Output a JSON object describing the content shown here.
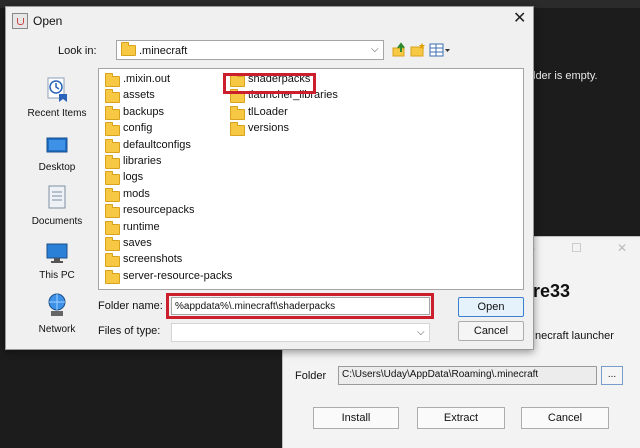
{
  "background": {
    "text": "lder is empty."
  },
  "installer": {
    "heading": "re33",
    "description": "necraft launcher",
    "folder_label": "Folder",
    "folder_value": "C:\\Users\\Uday\\AppData\\Roaming\\.minecraft",
    "browse_label": "...",
    "install_label": "Install",
    "extract_label": "Extract",
    "cancel_label": "Cancel"
  },
  "dialog": {
    "title": "Open",
    "look_in_label": "Look in:",
    "look_in_value": ".minecraft",
    "places": [
      {
        "label": "Recent Items",
        "icon": "recent-items-icon"
      },
      {
        "label": "Desktop",
        "icon": "desktop-icon"
      },
      {
        "label": "Documents",
        "icon": "documents-icon"
      },
      {
        "label": "This PC",
        "icon": "this-pc-icon"
      },
      {
        "label": "Network",
        "icon": "network-icon"
      }
    ],
    "files_col1": [
      ".mixin.out",
      "assets",
      "backups",
      "config",
      "defaultconfigs",
      "libraries",
      "logs",
      "mods",
      "resourcepacks",
      "runtime",
      "saves",
      "screenshots",
      "server-resource-packs"
    ],
    "files_col2": [
      "shaderpacks",
      "tlauncher_libraries",
      "tlLoader",
      "versions"
    ],
    "folder_name_label": "Folder name:",
    "folder_name_value": "%appdata%\\.minecraft\\shaderpacks",
    "files_of_type_label": "Files of type:",
    "files_of_type_value": "",
    "open_label": "Open",
    "cancel_label": "Cancel"
  },
  "colors": {
    "highlight": "#cc1f2d",
    "folder": "#f7c843",
    "accent": "#3c7fcf"
  }
}
